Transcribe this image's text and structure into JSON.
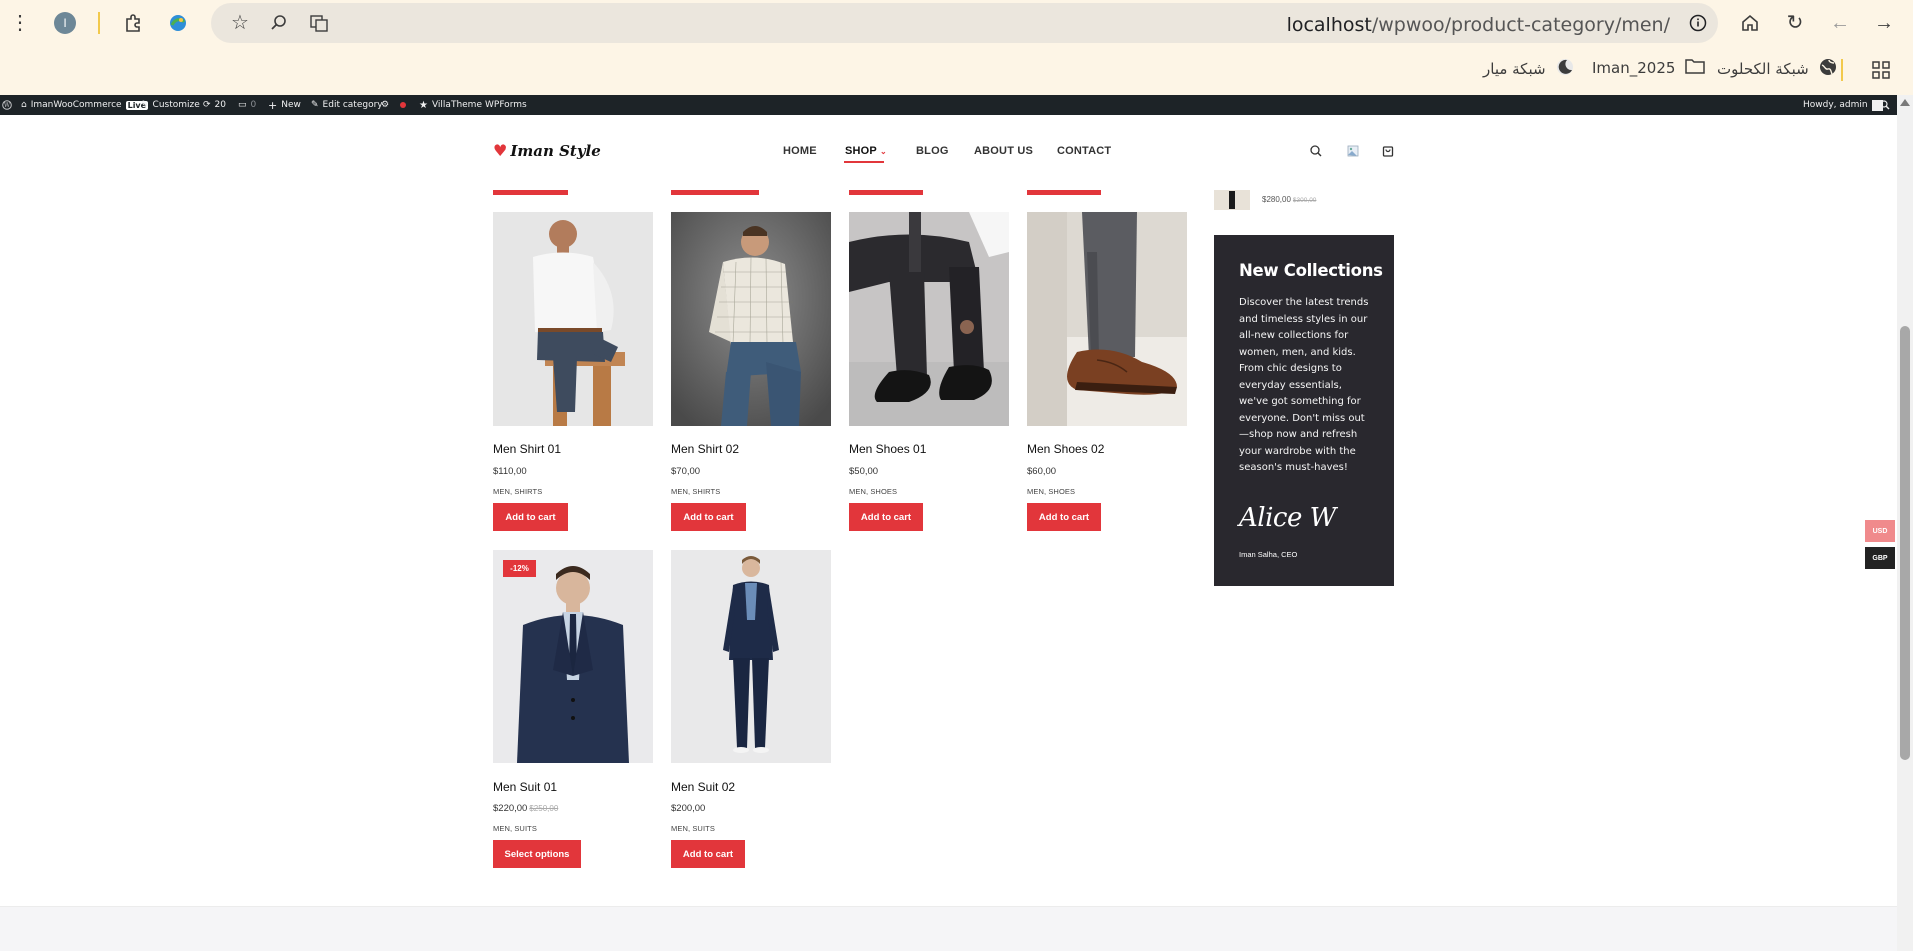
{
  "browser": {
    "avatar_letter": "I",
    "url_host": "localhost",
    "url_path": "/wpwoo/product-category/men/",
    "bookmarks": [
      {
        "label": "شبكة الكحلوت",
        "icon": "globe-icon"
      },
      {
        "label": "Iman_2025",
        "icon": "folder-icon"
      },
      {
        "label": "شبكة ميار",
        "icon": "moon-icon"
      }
    ]
  },
  "adminbar": {
    "site_name": "ImanWooCommerce",
    "live_badge": "Live",
    "customize": "Customize",
    "updates_count": "20",
    "comments_count": "0",
    "new": "New",
    "edit_category": "Edit category",
    "villatheme": "VillaTheme",
    "wpforms": "WPForms",
    "howdy": "Howdy, admin"
  },
  "header": {
    "logo_text": "Iman Style",
    "nav": [
      "HOME",
      "SHOP",
      "BLOG",
      "ABOUT US",
      "CONTACT"
    ],
    "active_nav": "SHOP"
  },
  "products": [
    {
      "title": "Men Shirt 01",
      "price": "$110,00",
      "old_price": "",
      "cats": "MEN, SHIRTS",
      "button": "Add to cart",
      "badge": ""
    },
    {
      "title": "Men Shirt 02",
      "price": "$70,00",
      "old_price": "",
      "cats": "MEN, SHIRTS",
      "button": "Add to cart",
      "badge": ""
    },
    {
      "title": "Men Shoes 01",
      "price": "$50,00",
      "old_price": "",
      "cats": "MEN, SHOES",
      "button": "Add to cart",
      "badge": ""
    },
    {
      "title": "Men Shoes 02",
      "price": "$60,00",
      "old_price": "",
      "cats": "MEN, SHOES",
      "button": "Add to cart",
      "badge": ""
    },
    {
      "title": "Men Suit 01",
      "price": "$220,00",
      "old_price": "$250,00",
      "cats": "MEN, SUITS",
      "button": "Select options",
      "badge": "-12%"
    },
    {
      "title": "Men Suit 02",
      "price": "$200,00",
      "old_price": "",
      "cats": "MEN, SUITS",
      "button": "Add to cart",
      "badge": ""
    }
  ],
  "sidebar": {
    "mini_price": "$280,00",
    "mini_old_price": "$300,00",
    "promo_title": "New Collections",
    "promo_text": "Discover the latest trends and timeless styles in our all-new collections for women, men, and kids. From chic designs to everyday essentials, we've got something for everyone. Don't miss out—shop now and refresh your wardrobe with the season's must-haves!",
    "promo_signature": "Alice W",
    "promo_author": "Iman Salha, CEO"
  },
  "currency": {
    "usd": "USD",
    "gbp": "GBP"
  },
  "colors": {
    "accent": "#e2363b",
    "dark_panel": "#29282e",
    "adminbar": "#1d2327",
    "chrome_bg": "#fdf5e6"
  }
}
